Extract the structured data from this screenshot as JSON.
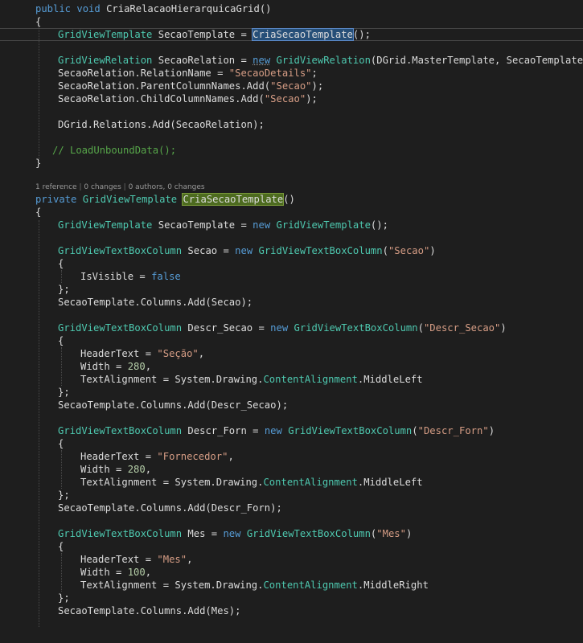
{
  "code_lens": {
    "references": "1 reference",
    "changes": "0 changes",
    "authors": "0 authors, 0 changes",
    "separator": "|"
  },
  "tokens": {
    "public": "public",
    "void": "void",
    "private": "private",
    "new": "new",
    "false": "false",
    "open_brace": "{",
    "close_brace": "}",
    "close_brace_semi": "};",
    "equals": " = ",
    "semi": ";",
    "method1": "CriaRelacaoHierarquicaGrid",
    "method2": "CriaSecaoTemplate",
    "GridViewTemplate": "GridViewTemplate",
    "GridViewRelation": "GridViewRelation",
    "GridViewTextBoxColumn": "GridViewTextBoxColumn",
    "ContentAlignment": "ContentAlignment"
  },
  "lines": {
    "l1_a": "public",
    "l1_b": " void ",
    "l1_c": "CriaRelacaoHierarquicaGrid()",
    "l3_var": " SecaoTemplate = ",
    "l3_call": "CriaSecaoTemplate",
    "l3_end": "();",
    "l5_var": " SecaoRelation = ",
    "l5_args": "(DGrid.MasterTemplate, SecaoTemplate);",
    "l6_a": "SecaoRelation.RelationName = ",
    "l6_str": "\"SecaoDetails\"",
    "l6_end": ";",
    "l7_a": "SecaoRelation.ParentColumnNames.Add(",
    "l7_str": "\"Secao\"",
    "l7_end": ");",
    "l8_a": "SecaoRelation.ChildColumnNames.Add(",
    "l8_str": "\"Secao\"",
    "l8_end": ");",
    "l10": "DGrid.Relations.Add(SecaoRelation);",
    "l12": "// LoadUnboundData();",
    "m_sig_end": "()",
    "m_l1_var": " SecaoTemplate = ",
    "m_l1_end": "();",
    "col1_var": " Secao = ",
    "col1_str": "\"Secao\"",
    "col1_end": ")",
    "col1_prop": "IsVisible = ",
    "col1_add": "SecaoTemplate.Columns.Add(Secao);",
    "col2_var": " Descr_Secao = ",
    "col2_str": "\"Descr_Secao\"",
    "col2_header": "HeaderText = ",
    "col2_header_str": "\"Seção\"",
    "width": "Width = ",
    "col2_width": "280",
    "align": "TextAlignment = System.Drawing.",
    "align_left": ".MiddleLeft",
    "align_right": ".MiddleRight",
    "col2_add": "SecaoTemplate.Columns.Add(Descr_Secao);",
    "col3_var": " Descr_Forn = ",
    "col3_str": "\"Descr_Forn\"",
    "col3_header_str": "\"Fornecedor\"",
    "col3_width": "280",
    "col3_add": "SecaoTemplate.Columns.Add(Descr_Forn);",
    "col4_var": " Mes = ",
    "col4_str": "\"Mes\"",
    "col4_header_str": "\"Mes\"",
    "col4_width": "100",
    "col4_add": "SecaoTemplate.Columns.Add(Mes);",
    "comma": ",",
    "open_paren": "(",
    "close_paren": ")"
  }
}
